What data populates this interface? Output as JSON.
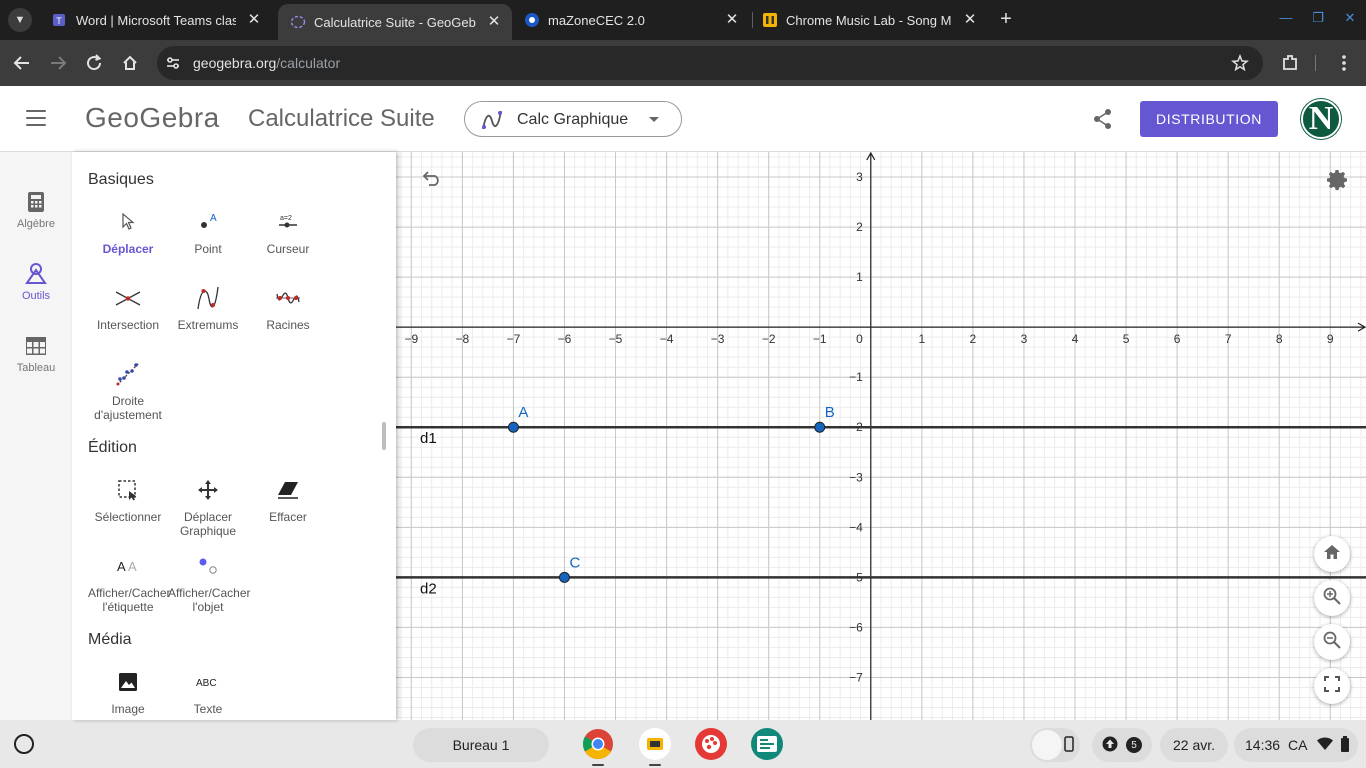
{
  "browser": {
    "tabs": [
      {
        "title": "Word | Microsoft Teams classic",
        "active": false
      },
      {
        "title": "Calculatrice Suite - GeoGebra",
        "active": true
      },
      {
        "title": "maZoneCEC 2.0",
        "active": false
      },
      {
        "title": "Chrome Music Lab - Song Maker",
        "active": false
      }
    ],
    "url_host": "geogebra.org",
    "url_path": "/calculator"
  },
  "header": {
    "logo": "GeoGebra",
    "app_title": "Calculatrice Suite",
    "app_picker": "Calc Graphique",
    "distribution_label": "DISTRIBUTION",
    "avatar_letter": "N",
    "accent_color": "#6557d2"
  },
  "rail": [
    {
      "label": "Algèbre",
      "icon": "calculator-icon"
    },
    {
      "label": "Outils",
      "icon": "tools-icon",
      "active": true
    },
    {
      "label": "Tableau",
      "icon": "table-icon"
    }
  ],
  "tools": {
    "sections": [
      {
        "title": "Basiques",
        "items": [
          {
            "label": "Déplacer",
            "icon": "move-icon",
            "active": true
          },
          {
            "label": "Point",
            "icon": "point-icon"
          },
          {
            "label": "Curseur",
            "icon": "slider-icon"
          },
          {
            "label": "Intersection",
            "icon": "intersection-icon"
          },
          {
            "label": "Extremums",
            "icon": "extremum-icon"
          },
          {
            "label": "Racines",
            "icon": "roots-icon"
          },
          {
            "label": "Droite d'ajustement",
            "icon": "fit-line-icon"
          }
        ]
      },
      {
        "title": "Édition",
        "items": [
          {
            "label": "Sélectionner",
            "icon": "select-icon"
          },
          {
            "label": "Déplacer Graphique",
            "icon": "move-graphics-icon"
          },
          {
            "label": "Effacer",
            "icon": "eraser-icon"
          },
          {
            "label": "Afficher/Cacher l'étiquette",
            "icon": "label-toggle-icon"
          },
          {
            "label": "Afficher/Cacher l'objet",
            "icon": "object-toggle-icon"
          }
        ]
      },
      {
        "title": "Média",
        "items": [
          {
            "label": "Image",
            "icon": "image-icon"
          },
          {
            "label": "Texte",
            "icon": "text-icon"
          }
        ]
      }
    ]
  },
  "chart_data": {
    "type": "scatter",
    "xlim": [
      -9.3,
      9.7
    ],
    "ylim": [
      -7.85,
      3.5
    ],
    "x_ticks": [
      -9,
      -8,
      -7,
      -6,
      -5,
      -4,
      -3,
      -2,
      -1,
      1,
      2,
      3,
      4,
      5,
      6,
      7,
      8,
      9
    ],
    "y_ticks": [
      -7,
      -6,
      -5,
      -4,
      -3,
      -2,
      -1,
      1,
      2,
      3
    ],
    "origin_label": "0",
    "grid": true,
    "points": [
      {
        "name": "A",
        "x": -7,
        "y": -2
      },
      {
        "name": "B",
        "x": -1,
        "y": -2
      },
      {
        "name": "C",
        "x": -6,
        "y": -5
      }
    ],
    "lines": [
      {
        "name": "d1",
        "y": -2
      },
      {
        "name": "d2",
        "y": -5
      }
    ],
    "point_color": "#1565c0"
  },
  "shelf": {
    "desk_label": "Bureau 1",
    "notif_count": "5",
    "date": "22 avr.",
    "time": "14:36",
    "locale": "CA"
  }
}
